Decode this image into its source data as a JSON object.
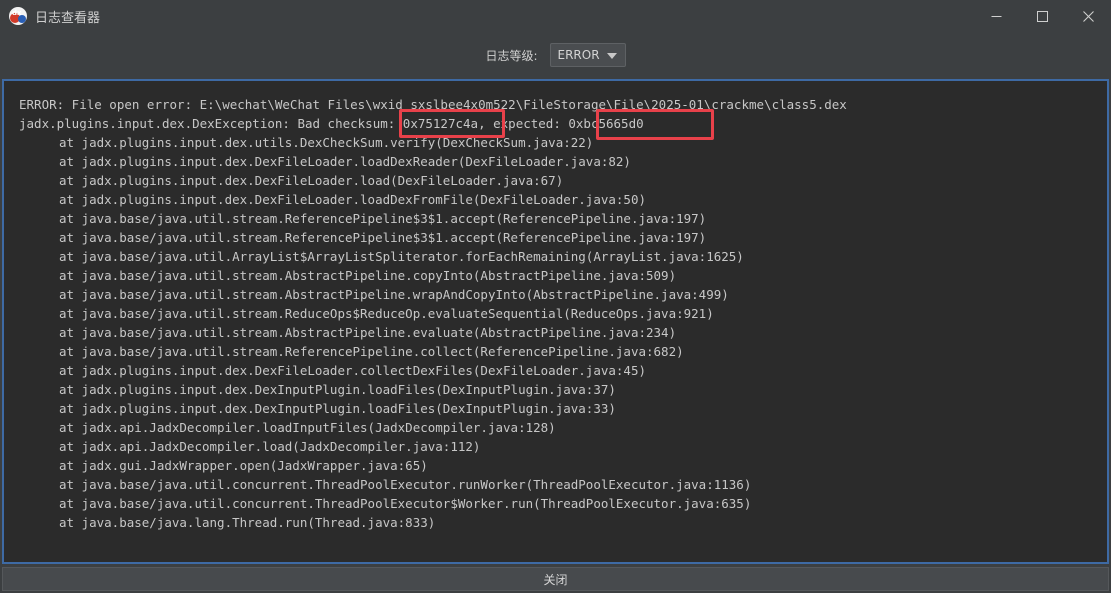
{
  "window": {
    "title": "日志查看器",
    "icon": "jadx-app-icon"
  },
  "toolbar": {
    "level_label": "日志等级:",
    "level_value": "ERROR"
  },
  "log": {
    "lines": [
      {
        "text": "ERROR: File open error: E:\\wechat\\WeChat Files\\wxid_sxslbee4x0m522\\FileStorage\\File\\2025-01\\crackme\\class5.dex",
        "indent": false
      },
      {
        "text": "jadx.plugins.input.dex.DexException: Bad checksum: 0x75127c4a, expected: 0xbc5665d0",
        "indent": false
      },
      {
        "text": "at jadx.plugins.input.dex.utils.DexCheckSum.verify(DexCheckSum.java:22)",
        "indent": true
      },
      {
        "text": "at jadx.plugins.input.dex.DexFileLoader.loadDexReader(DexFileLoader.java:82)",
        "indent": true
      },
      {
        "text": "at jadx.plugins.input.dex.DexFileLoader.load(DexFileLoader.java:67)",
        "indent": true
      },
      {
        "text": "at jadx.plugins.input.dex.DexFileLoader.loadDexFromFile(DexFileLoader.java:50)",
        "indent": true
      },
      {
        "text": "at java.base/java.util.stream.ReferencePipeline$3$1.accept(ReferencePipeline.java:197)",
        "indent": true
      },
      {
        "text": "at java.base/java.util.stream.ReferencePipeline$3$1.accept(ReferencePipeline.java:197)",
        "indent": true
      },
      {
        "text": "at java.base/java.util.ArrayList$ArrayListSpliterator.forEachRemaining(ArrayList.java:1625)",
        "indent": true
      },
      {
        "text": "at java.base/java.util.stream.AbstractPipeline.copyInto(AbstractPipeline.java:509)",
        "indent": true
      },
      {
        "text": "at java.base/java.util.stream.AbstractPipeline.wrapAndCopyInto(AbstractPipeline.java:499)",
        "indent": true
      },
      {
        "text": "at java.base/java.util.stream.ReduceOps$ReduceOp.evaluateSequential(ReduceOps.java:921)",
        "indent": true
      },
      {
        "text": "at java.base/java.util.stream.AbstractPipeline.evaluate(AbstractPipeline.java:234)",
        "indent": true
      },
      {
        "text": "at java.base/java.util.stream.ReferencePipeline.collect(ReferencePipeline.java:682)",
        "indent": true
      },
      {
        "text": "at jadx.plugins.input.dex.DexFileLoader.collectDexFiles(DexFileLoader.java:45)",
        "indent": true
      },
      {
        "text": "at jadx.plugins.input.dex.DexInputPlugin.loadFiles(DexInputPlugin.java:37)",
        "indent": true
      },
      {
        "text": "at jadx.plugins.input.dex.DexInputPlugin.loadFiles(DexInputPlugin.java:33)",
        "indent": true
      },
      {
        "text": "at jadx.api.JadxDecompiler.loadInputFiles(JadxDecompiler.java:128)",
        "indent": true
      },
      {
        "text": "at jadx.api.JadxDecompiler.load(JadxDecompiler.java:112)",
        "indent": true
      },
      {
        "text": "at jadx.gui.JadxWrapper.open(JadxWrapper.java:65)",
        "indent": true
      },
      {
        "text": "at java.base/java.util.concurrent.ThreadPoolExecutor.runWorker(ThreadPoolExecutor.java:1136)",
        "indent": true
      },
      {
        "text": "at java.base/java.util.concurrent.ThreadPoolExecutor$Worker.run(ThreadPoolExecutor.java:635)",
        "indent": true
      },
      {
        "text": "at java.base/java.lang.Thread.run(Thread.java:833)",
        "indent": true
      }
    ]
  },
  "highlights": [
    "0x75127c4a",
    "0xbc5665d0"
  ],
  "footer": {
    "close_label": "关闭"
  },
  "colors": {
    "accent_border": "#3e6aa4",
    "highlight_box": "#e8414a"
  }
}
